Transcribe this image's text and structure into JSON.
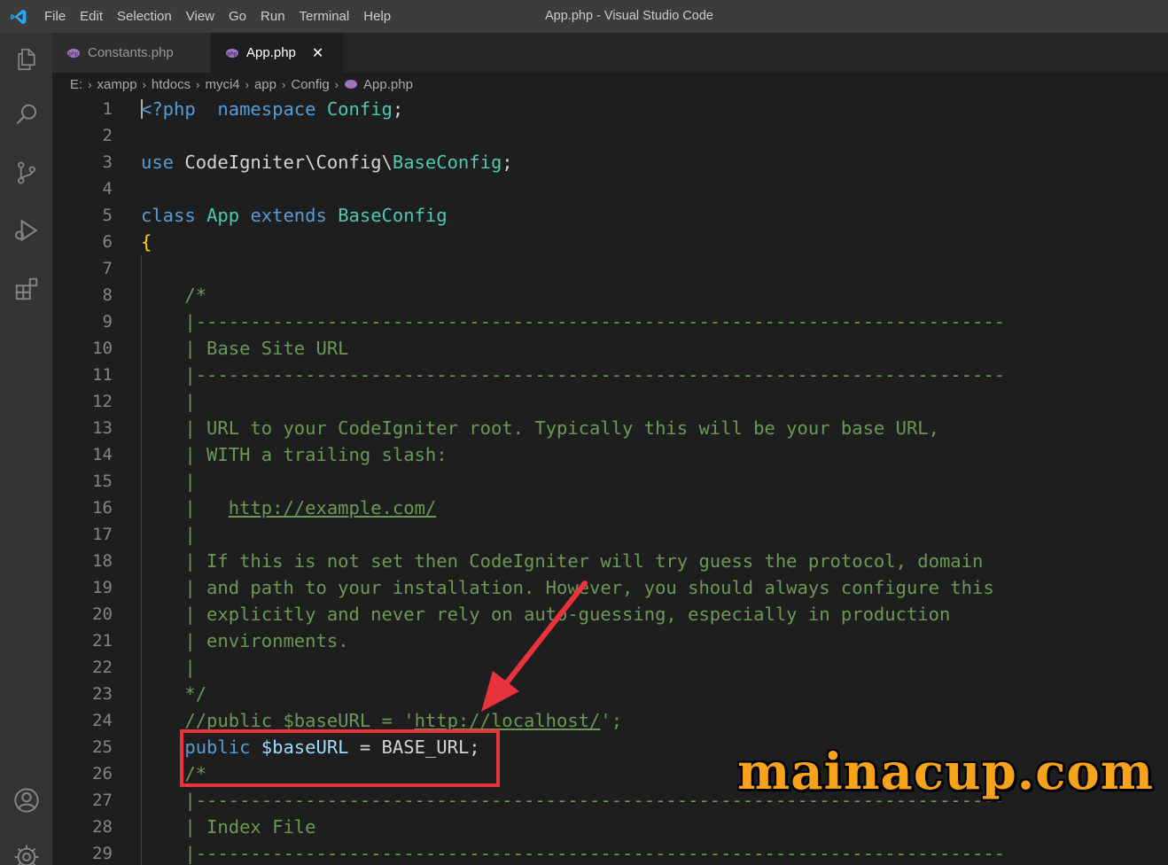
{
  "titlebar": {
    "menu": [
      "File",
      "Edit",
      "Selection",
      "View",
      "Go",
      "Run",
      "Terminal",
      "Help"
    ],
    "window_title": "App.php - Visual Studio Code"
  },
  "activity_bar": {
    "icons": [
      "explorer-icon",
      "search-icon",
      "source-control-icon",
      "run-debug-icon",
      "extensions-icon",
      "accounts-icon",
      "settings-gear-icon"
    ]
  },
  "tabs": [
    {
      "label": "Constants.php",
      "active": false
    },
    {
      "label": "App.php",
      "active": true,
      "close": "✕"
    }
  ],
  "breadcrumb": {
    "segments": [
      "E:",
      "xampp",
      "htdocs",
      "myci4",
      "app",
      "Config"
    ],
    "file": "App.php",
    "separator": "›"
  },
  "editor": {
    "line_numbers": [
      "1",
      "2",
      "3",
      "4",
      "5",
      "6",
      "7",
      "8",
      "9",
      "10",
      "11",
      "12",
      "13",
      "14",
      "15",
      "16",
      "17",
      "18",
      "19",
      "20",
      "21",
      "22",
      "23",
      "24",
      "25",
      "26",
      "27",
      "28",
      "29"
    ],
    "lines": [
      [
        [
          "kw",
          "<?php"
        ],
        [
          "",
          "  "
        ],
        [
          "kw",
          "namespace"
        ],
        [
          "",
          " "
        ],
        [
          "ty",
          "Config"
        ],
        [
          "",
          ";"
        ]
      ],
      [],
      [
        [
          "kw",
          "use"
        ],
        [
          "",
          " CodeIgniter\\Config\\"
        ],
        [
          "ty",
          "BaseConfig"
        ],
        [
          "",
          ";"
        ]
      ],
      [],
      [
        [
          "kw",
          "class"
        ],
        [
          "",
          " "
        ],
        [
          "ty",
          "App"
        ],
        [
          "",
          " "
        ],
        [
          "kw",
          "extends"
        ],
        [
          "",
          " "
        ],
        [
          "ty",
          "BaseConfig"
        ]
      ],
      [
        [
          "br",
          "{"
        ]
      ],
      [],
      [
        [
          "cm",
          "    /*"
        ]
      ],
      [
        [
          "cm",
          "    |--------------------------------------------------------------------------"
        ]
      ],
      [
        [
          "cm",
          "    | Base Site URL"
        ]
      ],
      [
        [
          "cm",
          "    |--------------------------------------------------------------------------"
        ]
      ],
      [
        [
          "cm",
          "    |"
        ]
      ],
      [
        [
          "cm",
          "    | URL to your CodeIgniter root. Typically this will be your base URL,"
        ]
      ],
      [
        [
          "cm",
          "    | WITH a trailing slash:"
        ]
      ],
      [
        [
          "cm",
          "    |"
        ]
      ],
      [
        [
          "cm",
          "    |   "
        ],
        [
          "cm ul",
          "http://example.com/"
        ]
      ],
      [
        [
          "cm",
          "    |"
        ]
      ],
      [
        [
          "cm",
          "    | If this is not set then CodeIgniter will try guess the protocol, domain"
        ]
      ],
      [
        [
          "cm",
          "    | and path to your installation. However, you should always configure this"
        ]
      ],
      [
        [
          "cm",
          "    | explicitly and never rely on auto-guessing, especially in production"
        ]
      ],
      [
        [
          "cm",
          "    | environments."
        ]
      ],
      [
        [
          "cm",
          "    |"
        ]
      ],
      [
        [
          "cm",
          "    */"
        ]
      ],
      [
        [
          "cm",
          "    //public $baseURL = '"
        ],
        [
          "cm ul",
          "http://localhost/"
        ],
        [
          "cm",
          "';"
        ]
      ],
      [
        [
          "",
          "    "
        ],
        [
          "kw",
          "public"
        ],
        [
          "",
          " "
        ],
        [
          "vr",
          "$baseURL"
        ],
        [
          "",
          " = BASE_URL;"
        ]
      ],
      [
        [
          "cm",
          "    /*"
        ]
      ],
      [
        [
          "cm",
          "    |--------------------------------------------------------------------------"
        ]
      ],
      [
        [
          "cm",
          "    | Index File"
        ]
      ],
      [
        [
          "cm",
          "    |--------------------------------------------------------------------------"
        ]
      ]
    ]
  },
  "annotation": {
    "arrow_color": "#e8323c",
    "box_color": "#e8323c"
  },
  "watermark": {
    "text": "mainacup.com",
    "color": "#f7a21b"
  }
}
